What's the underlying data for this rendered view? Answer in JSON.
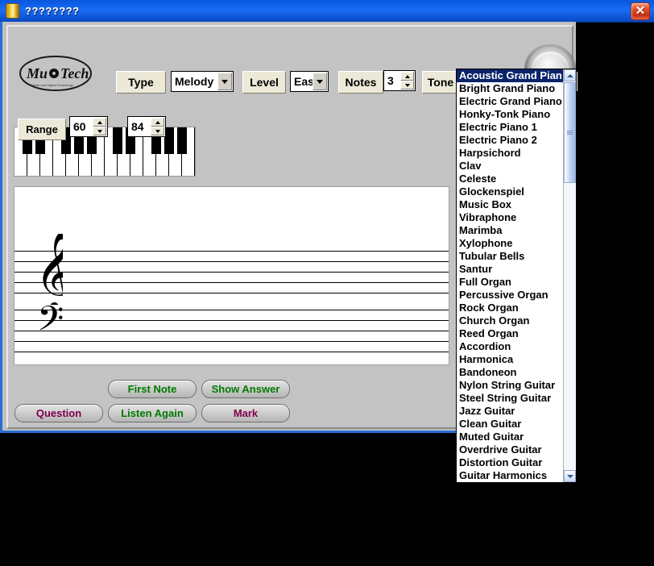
{
  "window": {
    "title": "????????",
    "icon": "app-icon",
    "close_label": "✕"
  },
  "logo": {
    "text_left": "Mu",
    "text_right": "Tech",
    "tagline": "Music and Digital Technology"
  },
  "toolbar": {
    "type_label": "Type",
    "type_value": "Melody",
    "level_label": "Level",
    "level_value": "Easy",
    "notes_label": "Notes",
    "notes_value": "3",
    "tone_label": "Tone",
    "tone_value": "Acoustic Grand Pian"
  },
  "range": {
    "label": "Range",
    "low": "60",
    "high": "84"
  },
  "buttons": {
    "first_note": "First Note",
    "show_answer": "Show Answer",
    "question": "Question",
    "listen_again": "Listen Again",
    "mark": "Mark"
  },
  "staff": {
    "treble_clef": "treble-clef",
    "bass_clef": "bass-clef"
  },
  "colors": {
    "accent_green": "#007a00",
    "accent_maroon": "#80004d",
    "title_blue": "#0a5ae6",
    "selection_blue": "#0a246a",
    "panel_gray": "#c3c3c3",
    "label_cream": "#ece9d8"
  },
  "tone_dropdown": {
    "selected_index": 0,
    "options": [
      "Acoustic Grand Pian",
      "Bright Grand Piano",
      "Electric Grand Piano",
      "Honky-Tonk Piano",
      "Electric Piano 1",
      "Electric Piano 2",
      "Harpsichord",
      "Clav",
      "Celeste",
      "Glockenspiel",
      "Music Box",
      "Vibraphone",
      "Marimba",
      "Xylophone",
      "Tubular Bells",
      "Santur",
      "Full Organ",
      "Percussive Organ",
      "Rock Organ",
      "Church Organ",
      "Reed Organ",
      "Accordion",
      "Harmonica",
      "Bandoneon",
      "Nylon String Guitar",
      "Steel String Guitar",
      "Jazz Guitar",
      "Clean Guitar",
      "Muted Guitar",
      "Overdrive Guitar",
      "Distortion Guitar",
      "Guitar Harmonics"
    ]
  }
}
